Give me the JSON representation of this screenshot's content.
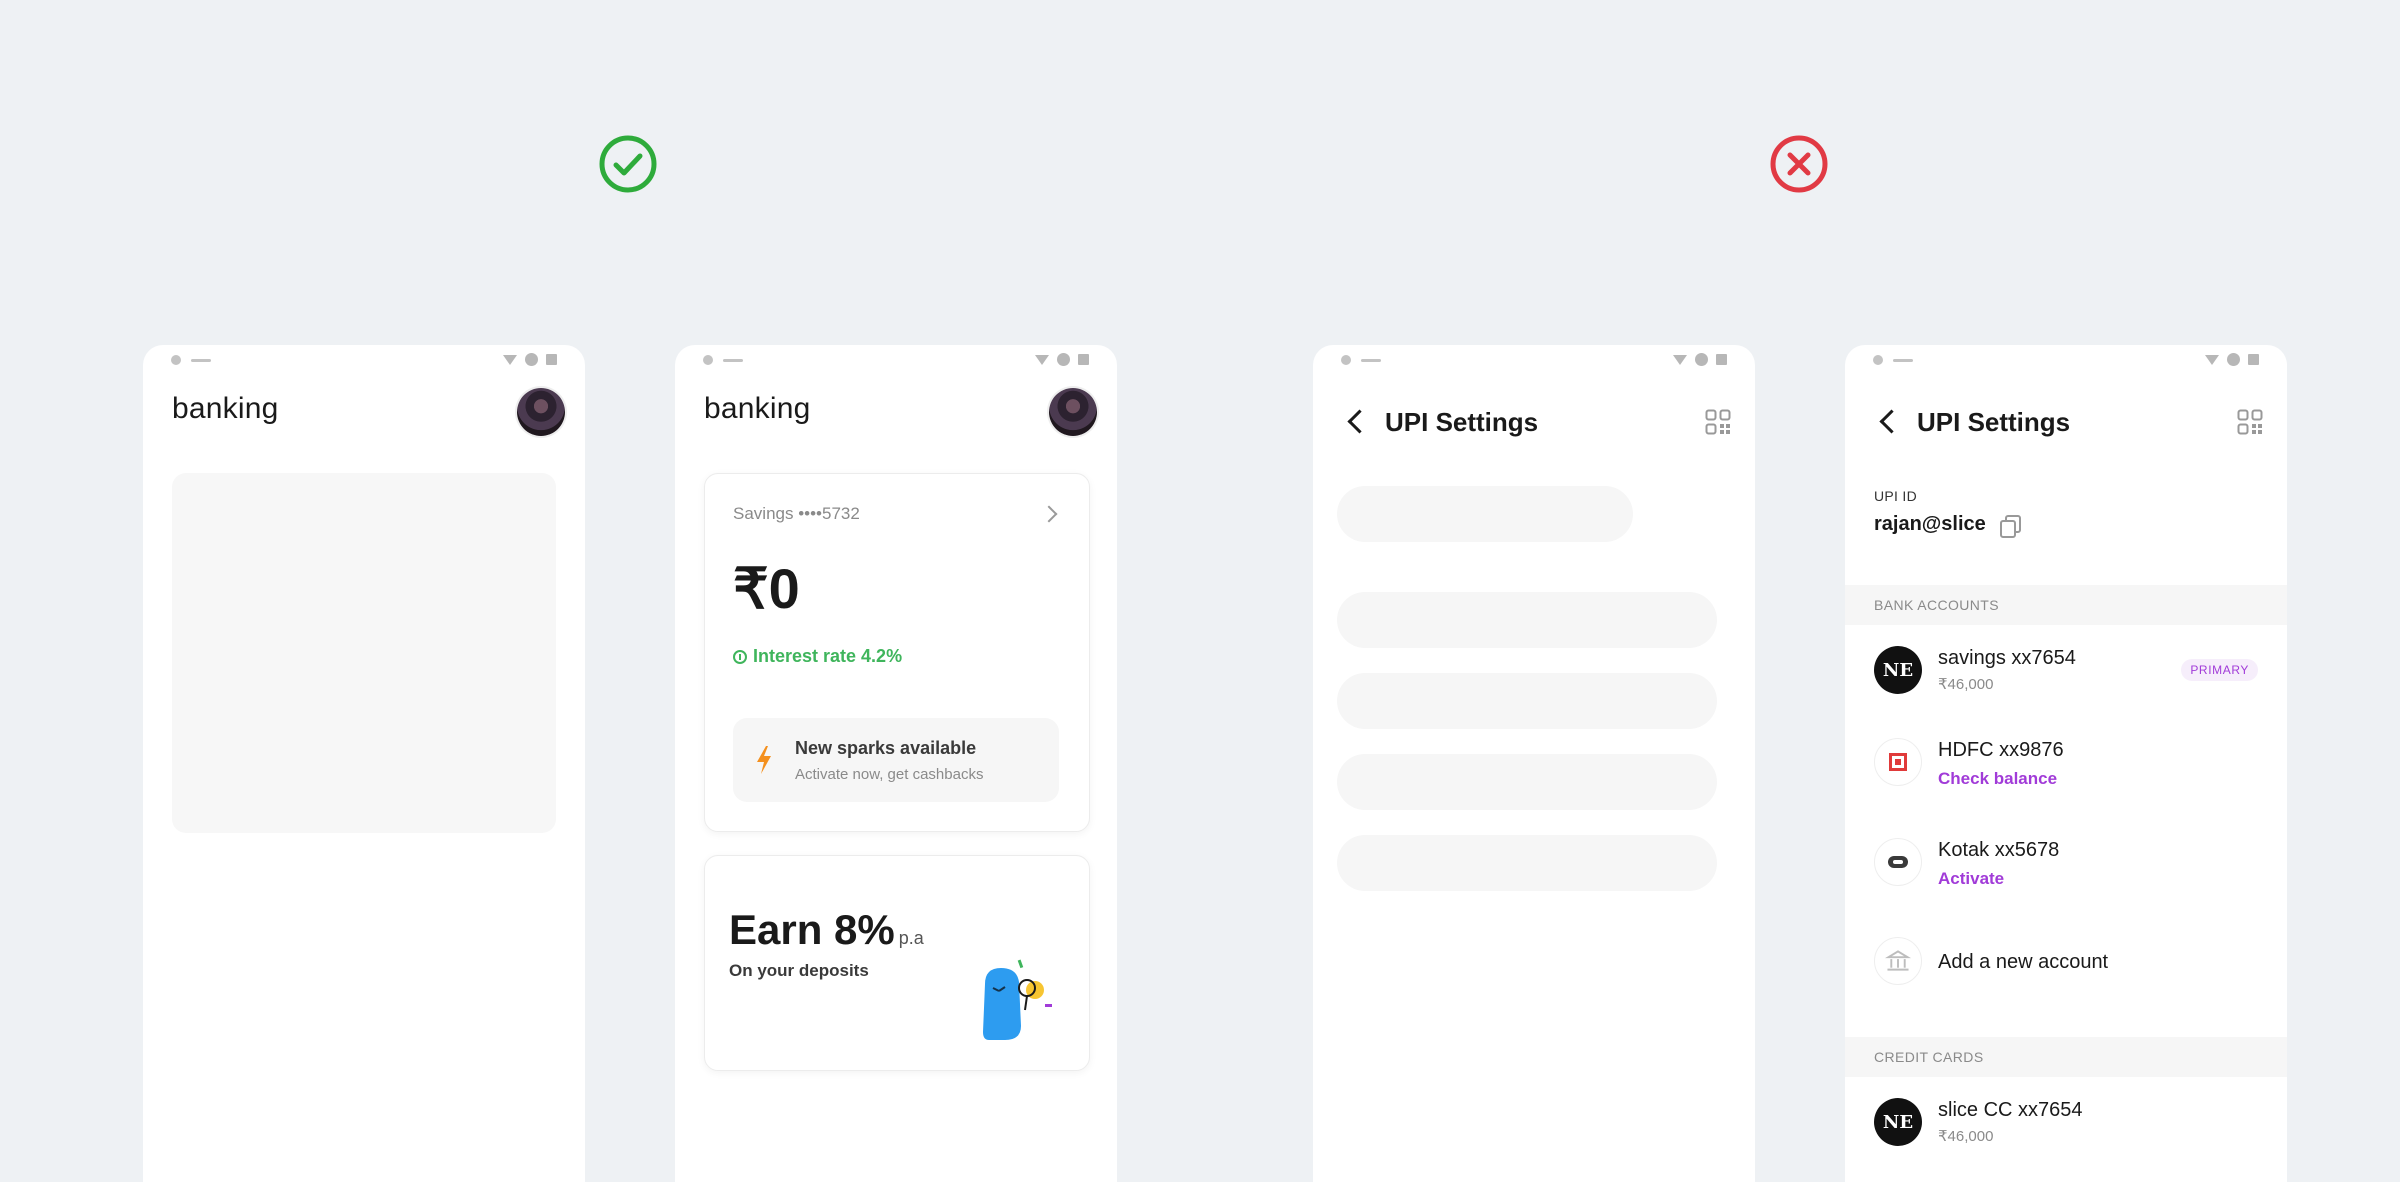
{
  "verdicts": {
    "good": {
      "name": "correct-check-icon",
      "color": "#2eab3b"
    },
    "bad": {
      "name": "incorrect-cross-icon",
      "color": "#e13a44"
    }
  },
  "screen1": {
    "title": "banking"
  },
  "screen2": {
    "title": "banking",
    "savings_label": "Savings ••••5732",
    "balance": "₹0",
    "interest": "Interest rate 4.2%",
    "sparks_title": "New sparks available",
    "sparks_sub": "Activate now, get cashbacks",
    "earn_title": "Earn 8%",
    "earn_pa": "p.a",
    "earn_sub": "On your deposits"
  },
  "screen3": {
    "title": "UPI Settings"
  },
  "screen4": {
    "title": "UPI Settings",
    "upi_id_label": "UPI ID",
    "upi_id_value": "rajan@slice",
    "bank_accounts_header": "BANK ACCOUNTS",
    "accounts": [
      {
        "logo": "NE",
        "name": "savings xx7654",
        "sub": "₹46,000",
        "badge": "PRIMARY"
      },
      {
        "logo": "",
        "name": "HDFC xx9876",
        "link": "Check balance"
      },
      {
        "logo": "",
        "name": "Kotak xx5678",
        "link": "Activate"
      }
    ],
    "add_account": "Add a new account",
    "credit_cards_header": "CREDIT CARDS",
    "cards": [
      {
        "logo": "NE",
        "name": "slice CC xx7654",
        "sub": "₹46,000"
      }
    ]
  },
  "colors": {
    "background": "#eef1f4",
    "accent_purple": "#a13bd8",
    "success_green": "#3fb55c",
    "spark_orange": "#f4901e"
  }
}
